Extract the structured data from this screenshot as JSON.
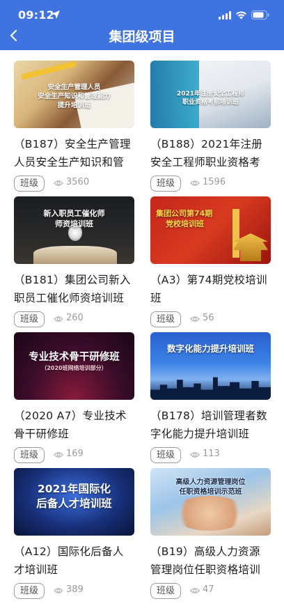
{
  "status_bar": {
    "time": "09:12"
  },
  "header": {
    "title": "集团级项目"
  },
  "courses": [
    {
      "thumb_text": [
        "安全生产管理人员",
        "安全生产知识和管理能力",
        "提升培训班"
      ],
      "title": "（B187）安全生产管理人员安全生产知识和管理…",
      "tag": "班级",
      "views": "3560"
    },
    {
      "thumb_text": [
        "2021年注册安全工程师",
        "职业资格考前培训班"
      ],
      "title": "（B188）2021年注册安全工程师职业资格考试考…",
      "tag": "班级",
      "views": "1596"
    },
    {
      "thumb_text": [
        "新入职员工催化师",
        "师资培训班"
      ],
      "title": "（B181）集团公司新入职员工催化师资培训班",
      "tag": "班级",
      "views": "260"
    },
    {
      "thumb_text": [
        "集团公司第74期",
        "党校培训班"
      ],
      "title": "（A3）第74期党校培训班",
      "tag": "班级",
      "views": "56"
    },
    {
      "thumb_text": [
        "专业技术骨干研修班",
        "（2020班网络培训部分）"
      ],
      "title": "（2020 A7）专业技术骨干研修班",
      "tag": "班级",
      "views": "169"
    },
    {
      "thumb_text": [
        "数字化能力提升培训班"
      ],
      "title": "（B178）培训管理者数字化能力提升培训班（第…",
      "tag": "班级",
      "views": "113"
    },
    {
      "thumb_text": [
        "2021年国际化",
        "后备人才培训班"
      ],
      "title": "（A12）国际化后备人才培训班",
      "tag": "班级",
      "views": "389"
    },
    {
      "thumb_text": [
        "高级人力资源管理岗位",
        "任职资格培训示范班"
      ],
      "title": "（B19）高级人力资源管理岗位任职资格培训示…",
      "tag": "班级",
      "views": "47"
    }
  ]
}
